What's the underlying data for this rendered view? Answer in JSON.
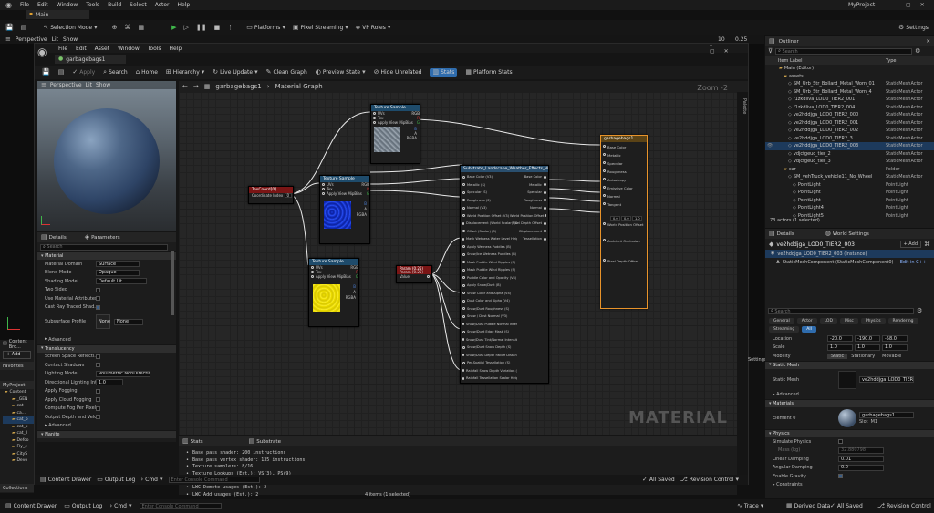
{
  "app": {
    "menus": [
      "File",
      "Edit",
      "Window",
      "Tools",
      "Build",
      "Select",
      "Actor",
      "Help"
    ],
    "project": "MyProject",
    "level_tab": "Main"
  },
  "main_toolbar": {
    "selection_mode": "Selection Mode",
    "platforms": "Platforms",
    "pixel_streaming": "Pixel Streaming",
    "vp_roles": "VP Roles",
    "settings": "Settings"
  },
  "viewport": {
    "perspective": "Perspective",
    "lit": "Lit",
    "show": "Show",
    "lod_values": [
      "10",
      "0.25"
    ]
  },
  "mat_editor": {
    "tab": "garbagebags1",
    "menus": [
      "File",
      "Edit",
      "Asset",
      "Window",
      "Tools",
      "Help"
    ],
    "toolbar": [
      "Apply",
      "Search",
      "Home",
      "Hierarchy",
      "Live Update",
      "Clean Graph",
      "Preview State",
      "Hide Unrelated",
      "Stats",
      "Platform Stats"
    ],
    "preview": {
      "perspective": "Perspective",
      "lit": "Lit",
      "show": "Show"
    },
    "breadcrumb": {
      "asset": "garbagebags1",
      "graph": "Material Graph"
    },
    "zoom": "Zoom -2",
    "palette": "Palette",
    "watermark": "MATERIAL",
    "tabs": {
      "details": "Details",
      "parameters": "Parameters"
    },
    "search_placeholder": "Search",
    "material_section": "Material",
    "props": [
      {
        "label": "Material Domain",
        "value": "Surface"
      },
      {
        "label": "Blend Mode",
        "value": "Opaque"
      },
      {
        "label": "Shading Model",
        "value": "Default Lit"
      },
      {
        "label": "Two Sided",
        "value": ""
      },
      {
        "label": "Use Material Attributes",
        "value": ""
      },
      {
        "label": "Cast Ray Traced Shad...",
        "value": ""
      },
      {
        "label": "Subsurface Profile",
        "value": "None"
      }
    ],
    "advanced": "Advanced",
    "translucency": "Translucency",
    "trans_props": [
      {
        "label": "Screen Space Reflecti...",
        "value": ""
      },
      {
        "label": "Contact Shadows",
        "value": ""
      },
      {
        "label": "Lighting Mode",
        "value": "Volumetric NonDirectional"
      },
      {
        "label": "Directional Lighting Int...",
        "value": "1.0"
      },
      {
        "label": "Apply Fogging",
        "value": ""
      },
      {
        "label": "Apply Cloud Fogging",
        "value": ""
      },
      {
        "label": "Compute Fog Per Pixel",
        "value": ""
      },
      {
        "label": "Output Depth and Velo...",
        "value": ""
      }
    ],
    "advanced2": "Advanced",
    "nanite": "Nanite",
    "stats_tabs": [
      "Stats",
      "Substrate"
    ],
    "stats": [
      "Base pass shader: 200 instructions",
      "Base pass vertex shader: 135 instructions",
      "Texture samplers: 8/16",
      "Texture Lookups (Est.): VS(3), PS(9)",
      "User interpolators: 2/4 Scalars (1/4 Vectors) (TexCoords: 2, Custom: 0)",
      "LWC Demote usages (Est.): 2",
      "LWC Add usages (Est.): 2"
    ],
    "content_drawer": "Content Drawer",
    "output_log": "Output Log",
    "cmd": "Cmd",
    "console_placeholder": "Enter Console Command",
    "all_saved": "All Saved",
    "revision_control": "Revision Control"
  },
  "graph": {
    "texcoord": {
      "title": "TexCoord[0]",
      "pin": "Coordinate Index",
      "value": "0"
    },
    "tex_samples": [
      {
        "title": "Texture Sample",
        "pins": [
          "UVs",
          "Tex",
          "Apply View MipBias"
        ],
        "outs": [
          "RGB",
          "R",
          "G",
          "B",
          "A",
          "RGBA"
        ]
      },
      {
        "title": "Texture Sample",
        "pins": [
          "UVs",
          "Tex",
          "Apply View MipBias"
        ],
        "outs": [
          "RGB",
          "R",
          "G",
          "B",
          "A",
          "RGBA"
        ]
      },
      {
        "title": "Texture Sample",
        "pins": [
          "UVs",
          "Tex",
          "Apply View MipBias"
        ],
        "outs": [
          "RGB",
          "R",
          "G",
          "B",
          "A",
          "RGBA"
        ]
      }
    ],
    "scalar": {
      "title": "Param (0.25)",
      "sub": "Param (0.25)",
      "pin": "Value"
    },
    "substrate": {
      "title": "Substrate_Landscape_Weather_Effects_V0",
      "ins": [
        "Base Color (V3)",
        "Metallic (S)",
        "Specular (S)",
        "Roughness (S)",
        "Normal (V3)",
        "World Position Offset (V3)",
        "Displacement (World Scalar) (S)",
        "Offset (Scalar) (S)",
        "Mask Wetness Water Level Height (S)",
        "Apply Wetness Puddles (B)",
        "Snow/Ice Wetness Puddles (B)",
        "Mask Puddle Wind Ripples (S)",
        "Mask Puddle Wind Ripples (S)",
        "Puddle Color and Opacity (V4)",
        "Apply Snow/Dust (B)",
        "Snow Color and Alpha (V4)",
        "Dust Color and Alpha (V4)",
        "Snow/Dust Roughness (S)",
        "Snow / Dust Normal (V3)",
        "Snow/Dust Puddle Normal Intensity (S)",
        "Snow/Dust Edge Mask (S)",
        "Snow/Dust Tint/Normal Intensity (S)",
        "Snow/Dust Snow Depth (S)",
        "Snow/Dust Depth Falloff Distance (S)",
        "Per-Spatial Tessellation (S)",
        "Rainfall Snow Depth Variation (S)",
        "Rainfall Tessellation Scalar Height (S)"
      ],
      "outs": [
        "Base Color",
        "Metallic",
        "Specular",
        "Roughness",
        "Normal",
        "World Position Offset",
        "Pixel Depth Offset",
        "Displacement",
        "Tessellation"
      ]
    },
    "result": {
      "title": "garbagebags1",
      "pins": [
        "Base Color",
        "Metallic",
        "Specular",
        "Roughness",
        "Anisotropy",
        "Emissive Color",
        "Normal",
        "Tangent",
        "World Position Offset",
        "Ambient Occlusion",
        "Pixel Depth Offset"
      ],
      "vec_values": [
        "0.0",
        "0.0",
        "1.0"
      ]
    }
  },
  "outliner": {
    "title": "Outliner",
    "search_placeholder": "Search",
    "col_label": "Item Label",
    "col_type": "Type",
    "items": [
      {
        "label": "Main (Editor)",
        "type": "",
        "indent": 1
      },
      {
        "label": "assets",
        "type": "",
        "indent": 2
      },
      {
        "label": "SM_Urb_Str_Bollard_Metal_Worn_01",
        "type": "StaticMeshActor",
        "indent": 3
      },
      {
        "label": "SM_Urb_Str_Bollard_Metal_Worn_4",
        "type": "StaticMeshActor",
        "indent": 3
      },
      {
        "label": "f1zkdliva_LOD0_TIER2_001",
        "type": "StaticMeshActor",
        "indent": 3
      },
      {
        "label": "f1zkdliva_LOD0_TIER2_004",
        "type": "StaticMeshActor",
        "indent": 3
      },
      {
        "label": "ve2hddjga_LOD0_TIER2_000",
        "type": "StaticMeshActor",
        "indent": 3
      },
      {
        "label": "ve2hddjga_LOD0_TIER2_001",
        "type": "StaticMeshActor",
        "indent": 3
      },
      {
        "label": "ve2hddjga_LOD0_TIER2_002",
        "type": "StaticMeshActor",
        "indent": 3
      },
      {
        "label": "ve2hddjga_LOD0_TIER2_3",
        "type": "StaticMeshActor",
        "indent": 3
      },
      {
        "label": "ve2hddjga_LOD0_TIER2_003",
        "type": "StaticMeshActor",
        "indent": 3,
        "selected": true
      },
      {
        "label": "vdjcfgeuc_tier_2",
        "type": "StaticMeshActor",
        "indent": 3
      },
      {
        "label": "vdjcfgeuc_tier_3",
        "type": "StaticMeshActor",
        "indent": 3
      },
      {
        "label": "car",
        "type": "Folder",
        "indent": 2
      },
      {
        "label": "SM_vehTruck_vehicle11_No_Wheel",
        "type": "StaticMeshActor",
        "indent": 3
      },
      {
        "label": "PointLight",
        "type": "PointLight",
        "indent": 4
      },
      {
        "label": "PointLight",
        "type": "PointLight",
        "indent": 4
      },
      {
        "label": "PointLight",
        "type": "PointLight",
        "indent": 4
      },
      {
        "label": "PointLight4",
        "type": "PointLight",
        "indent": 4
      },
      {
        "label": "PointLight5",
        "type": "PointLight",
        "indent": 4
      }
    ],
    "count": "73 actors (1 selected)"
  },
  "details": {
    "tab": "Details",
    "world_settings": "World Settings",
    "actor_name": "ve2hddjga_LOD0_TIER2_003",
    "add_label": "+ Add",
    "component_root": "ve2hddjga_LOD0_TIER2_003 (Instance)",
    "component": "StaticMeshComponent (StaticMeshComponent0)",
    "edit_cpp": "Edit in C++",
    "search_placeholder": "Search",
    "filter_tabs": [
      "General",
      "Actor",
      "LOD",
      "Misc",
      "Physics",
      "Rendering",
      "Streaming",
      "All"
    ],
    "transform": [
      {
        "label": "Location",
        "v": [
          "-20.0",
          "-190.0",
          "-58.0"
        ]
      },
      {
        "label": "Scale",
        "v": [
          "1.0",
          "1.0",
          "1.0"
        ]
      }
    ],
    "mobility_label": "Mobility",
    "mobility": [
      "Static",
      "Stationary",
      "Movable"
    ],
    "static_mesh_section": "Static Mesh",
    "static_mesh_label": "Static Mesh",
    "static_mesh_value": "ve2hddjga_LOD0_TIER2_00",
    "advanced": "Advanced",
    "materials_section": "Materials",
    "element_label": "Element 0",
    "material_value": "garbagebags1",
    "material_source": "Slot",
    "material_mi": "M1",
    "physics_section": "Physics",
    "physics_props": [
      {
        "label": "Simulate Physics",
        "value": ""
      },
      {
        "label": "Mass (kg)",
        "value": "32.880798"
      },
      {
        "label": "Linear Damping",
        "value": "0.01"
      },
      {
        "label": "Angular Damping",
        "value": "0.0"
      },
      {
        "label": "Enable Gravity",
        "value": ""
      }
    ],
    "constraints": "Constraints"
  },
  "content_browser": {
    "title": "Content Bro...",
    "add": "+ Add",
    "favorites": "Favorites",
    "project": "MyProject",
    "folders": [
      "Content",
      "_GEN",
      "cat",
      "ca...",
      "cat_b",
      "cat_k",
      "cat_ll",
      "Defco",
      "Fly_c",
      "CityS",
      "Devo"
    ],
    "collections": "Collections",
    "items_count": "4 items (1 selected)",
    "settings": "Settings"
  },
  "bottom": {
    "content_drawer": "Content Drawer",
    "output_log": "Output Log",
    "cmd": "Cmd",
    "console_placeholder": "Enter Console Command",
    "trace": "Trace",
    "derived_data": "Derived Data",
    "all_saved": "All Saved",
    "revision_control": "Revision Control"
  },
  "colors": {
    "bg": "#111111",
    "panel": "#1b1b1b",
    "accent": "#2f6cad",
    "selected_row": "#1d3a5c",
    "result_border": "#e8932a",
    "tex_header": "#1e4b6b",
    "scalar_header": "#7a1515",
    "substrate_header": "#2a4f6e"
  }
}
